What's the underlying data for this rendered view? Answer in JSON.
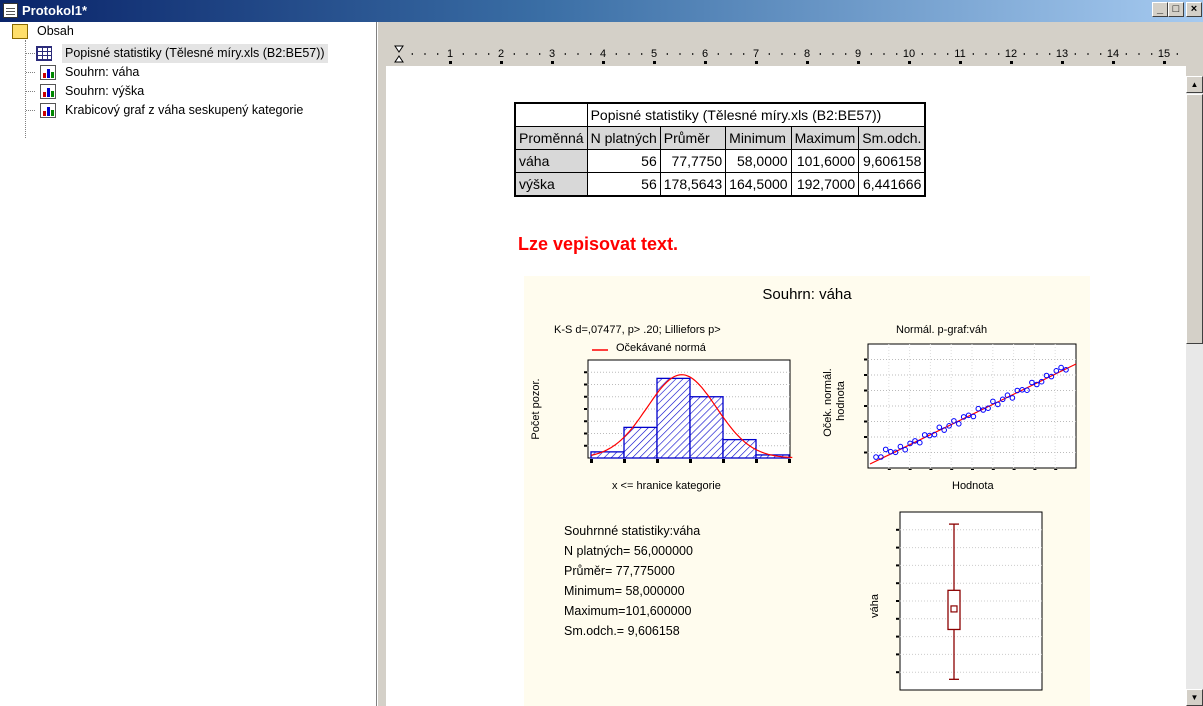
{
  "window": {
    "title": "Protokol1*",
    "min_label": "_",
    "max_label": "□",
    "close_label": "×"
  },
  "tree": {
    "root": "Obsah",
    "items": [
      {
        "label": "Popisné statistiky (Tělesné míry.xls (B2:BE57))",
        "icon": "table-icon",
        "selected": true
      },
      {
        "label": "Souhrn: váha",
        "icon": "graph-icon"
      },
      {
        "label": "Souhrn: výška",
        "icon": "graph-icon"
      },
      {
        "label": "Krabicový graf z váha seskupený kategorie",
        "icon": "graph-icon"
      }
    ]
  },
  "ruler": {
    "ticks": [
      "1",
      "2",
      "3",
      "4",
      "5",
      "6",
      "7",
      "8",
      "9",
      "10",
      "11",
      "12",
      "13",
      "14",
      "15"
    ]
  },
  "table": {
    "caption": "Popisné statistiky (Tělesné míry.xls (B2:BE57))",
    "row_header": "Proměnná",
    "columns": [
      "N platných",
      "Průměr",
      "Minimum",
      "Maximum",
      "Sm.odch."
    ],
    "rows": [
      {
        "name": "váha",
        "values": [
          "56",
          "77,7750",
          "58,0000",
          "101,6000",
          "9,606158"
        ]
      },
      {
        "name": "výška",
        "values": [
          "56",
          "178,5643",
          "164,5000",
          "192,7000",
          "6,441666"
        ]
      }
    ]
  },
  "note": "Lze vepisovat text.",
  "summary": {
    "title": "Souhrn: váha",
    "stats_lines": [
      "Souhrnné statistiky:váha",
      "N platných= 56,000000",
      "Průměr= 77,775000",
      "Minimum= 58,000000",
      "Maximum=101,600000",
      "Sm.odch.=  9,606158"
    ]
  },
  "chart_data": [
    {
      "type": "bar",
      "title": "K-S d=,07477, p> .20; Lilliefors p>",
      "legend": "Očekávané normá",
      "xlabel": "x <= hranice kategorie",
      "ylabel": "Počet pozor.",
      "values": [
        1,
        5,
        13,
        10,
        3,
        0.5
      ],
      "ylim": [
        0,
        16
      ],
      "curve_color": "#ff0000",
      "bar_color": "#0000cc"
    },
    {
      "type": "scatter",
      "title": "Normál. p-graf:váh",
      "xlabel": "Hodnota",
      "ylabel": "Oček. normál. hodnota",
      "point_color": "#0000ff",
      "line_color": "#ff0000"
    },
    {
      "type": "box",
      "ylabel": "váha",
      "values": {
        "min": 58.0,
        "q1": 72.0,
        "median": 77.0,
        "mean": 77.775,
        "q3": 83.0,
        "max": 101.6
      },
      "ylim": [
        55,
        105
      ],
      "color": "#8b0000"
    }
  ]
}
